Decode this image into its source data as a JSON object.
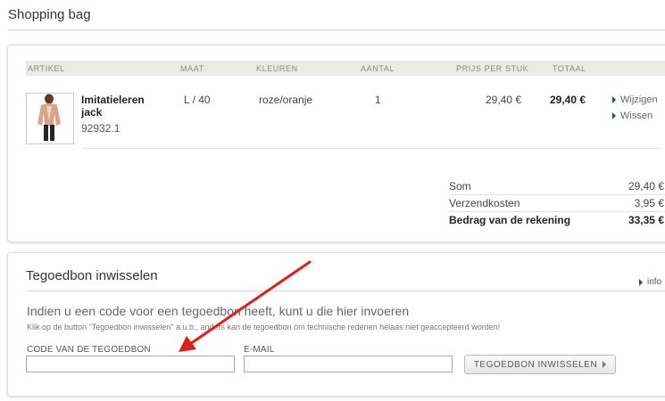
{
  "page": {
    "title": "Shopping bag"
  },
  "table": {
    "headers": {
      "article": "ARTIKEL",
      "size": "MAAT",
      "colors": "KLEUREN",
      "qty": "AANTAL",
      "unit_price": "PRIJS PER STUK",
      "total": "TOTAAL"
    },
    "item": {
      "name": "Imitatieleren jack",
      "code": "92932.1",
      "size": "L / 40",
      "color": "roze/oranje",
      "qty": "1",
      "unit_price": "29,40 €",
      "total": "29,40 €",
      "actions": {
        "edit": "Wijzigen",
        "remove": "Wissen"
      }
    }
  },
  "summary": {
    "subtotal_label": "Som",
    "subtotal_value": "29,40 €",
    "shipping_label": "Verzendkosten",
    "shipping_value": "3,95 €",
    "total_label": "Bedrag van de rekening",
    "total_value": "33,35 €"
  },
  "voucher": {
    "title": "Tegoedbon inwisselen",
    "info_label": "info",
    "intro": "Indien u een code voor een tegoedbon heeft, kunt u die hier invoeren",
    "note": "Klik op de button \"Tegoedbon inwisselen\" a.u.b., anders kan de tegoedbon om technische redenen helaas niet geaccepteerd worden!",
    "code_label": "CODE VAN DE TEGOEDBON",
    "code_value": "",
    "email_label": "E-MAIL",
    "email_value": "",
    "button_label": "TEGOEDBON INWISSELEN"
  },
  "colors": {
    "annotation_arrow": "#e31b1b",
    "header_bg": "#eceae5",
    "link_triangle": "#2a4a8a"
  }
}
